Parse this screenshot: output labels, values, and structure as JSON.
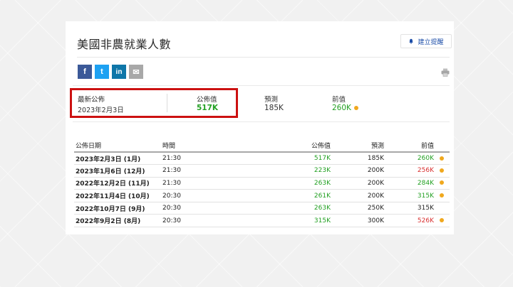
{
  "page": {
    "title": "美國非農就業人數",
    "alert_button": "建立提醒"
  },
  "share": {
    "facebook": "f",
    "twitter": "t",
    "linkedin": "in",
    "email": "✉"
  },
  "summary": {
    "latest_label": "最新公佈",
    "latest_date": "2023年2月3日",
    "actual_label": "公佈值",
    "actual_value": "517K",
    "forecast_label": "預測",
    "forecast_value": "185K",
    "previous_label": "前值",
    "previous_value": "260K",
    "colors": {
      "green": "#22a022",
      "red": "#d93030",
      "dot": "#f0a81e",
      "highlight_border": "#cc1111"
    }
  },
  "table": {
    "headers": [
      "公佈日期",
      "時間",
      "公佈值",
      "預測",
      "前值"
    ],
    "rows": [
      {
        "date": "2023年2月3日 (1月)",
        "time": "21:30",
        "actual": "517K",
        "forecast": "185K",
        "previous": "260K",
        "previous_color": "green",
        "dot": true
      },
      {
        "date": "2023年1月6日 (12月)",
        "time": "21:30",
        "actual": "223K",
        "forecast": "200K",
        "previous": "256K",
        "previous_color": "red",
        "dot": true
      },
      {
        "date": "2022年12月2日 (11月)",
        "time": "21:30",
        "actual": "263K",
        "forecast": "200K",
        "previous": "284K",
        "previous_color": "green",
        "dot": true
      },
      {
        "date": "2022年11月4日 (10月)",
        "time": "20:30",
        "actual": "261K",
        "forecast": "200K",
        "previous": "315K",
        "previous_color": "green",
        "dot": true
      },
      {
        "date": "2022年10月7日 (9月)",
        "time": "20:30",
        "actual": "263K",
        "forecast": "250K",
        "previous": "315K",
        "previous_color": "black",
        "dot": false
      },
      {
        "date": "2022年9月2日 (8月)",
        "time": "20:30",
        "actual": "315K",
        "forecast": "300K",
        "previous": "526K",
        "previous_color": "red",
        "dot": true
      }
    ]
  }
}
